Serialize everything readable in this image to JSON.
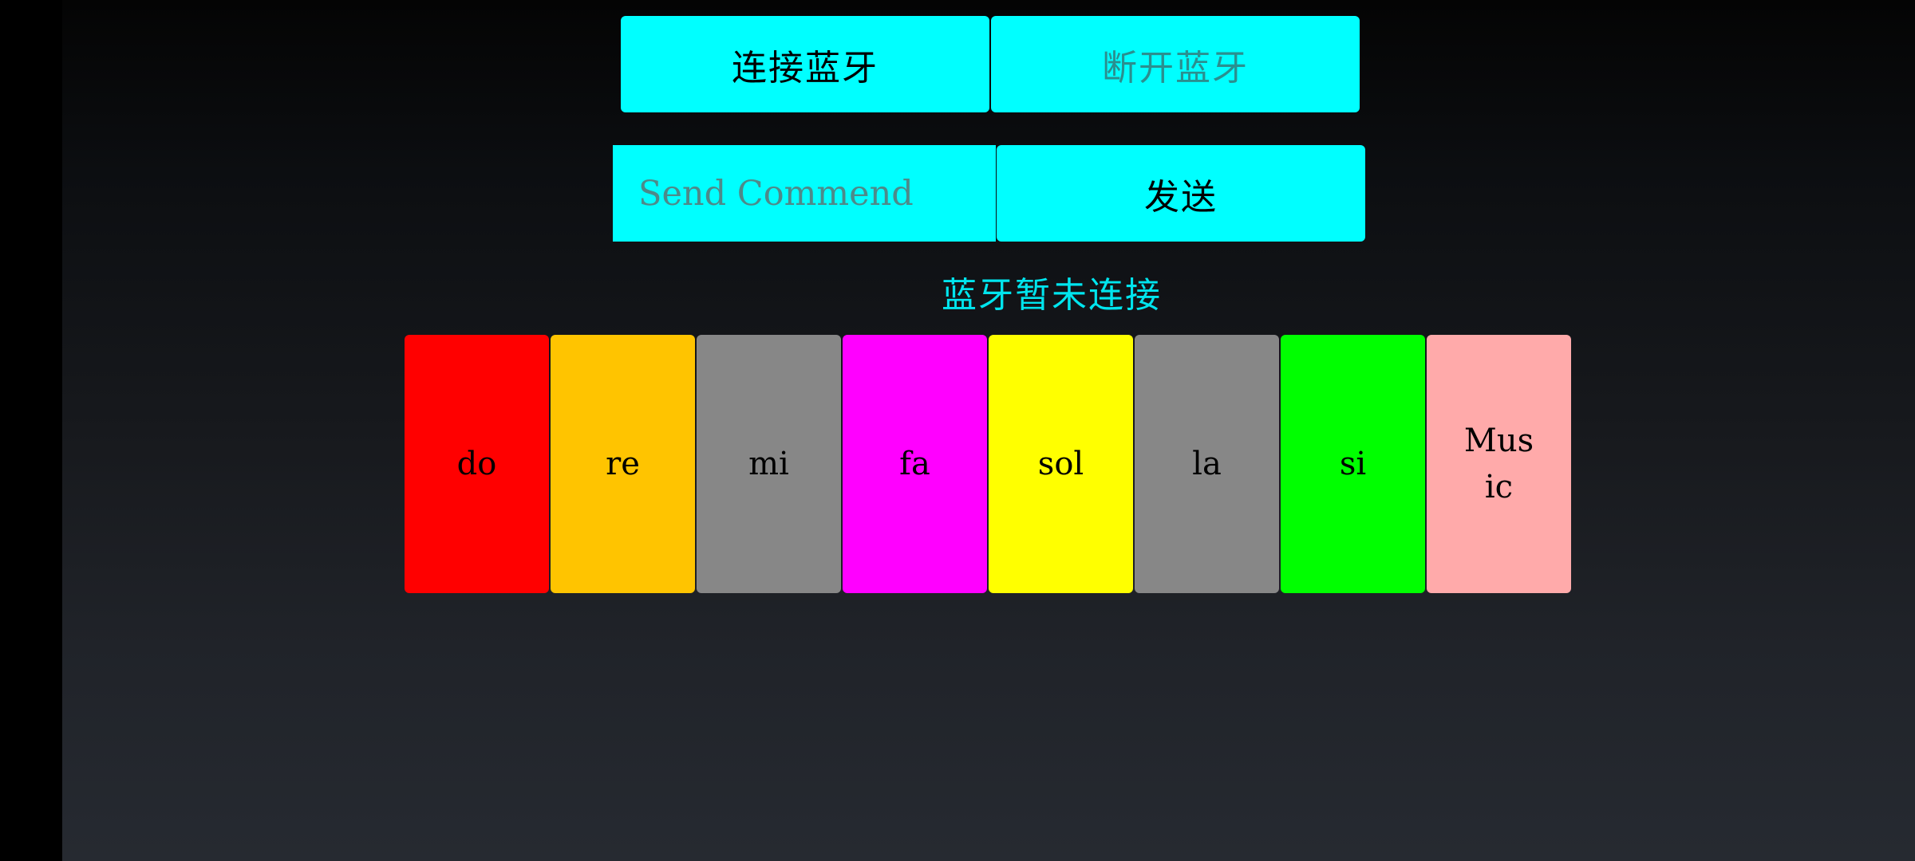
{
  "bluetooth": {
    "connect_label": "连接蓝牙",
    "disconnect_label": "断开蓝牙"
  },
  "command": {
    "placeholder": "Send Commend",
    "value": "",
    "send_label": "发送"
  },
  "status": {
    "text": "蓝牙暂未连接",
    "color": "#00e5ee"
  },
  "colors": {
    "accent": "#00ffff"
  },
  "keys": [
    {
      "label": "do",
      "color": "#ff0000"
    },
    {
      "label": "re",
      "color": "#ffc400"
    },
    {
      "label": "mi",
      "color": "#878787"
    },
    {
      "label": "fa",
      "color": "#ff00ff"
    },
    {
      "label": "sol",
      "color": "#ffff00"
    },
    {
      "label": "la",
      "color": "#878787"
    },
    {
      "label": "si",
      "color": "#00ff00"
    },
    {
      "label": "Music",
      "color": "#ffaaaa"
    }
  ]
}
